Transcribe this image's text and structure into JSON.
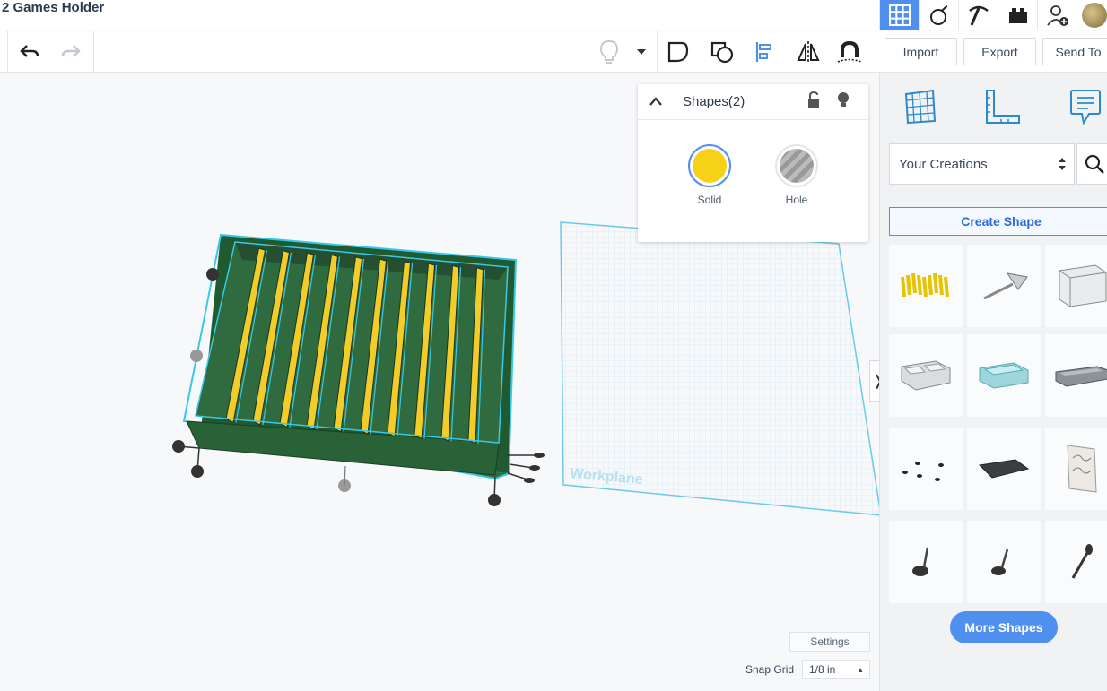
{
  "header": {
    "title": "2 Games Holder"
  },
  "top_icons": [
    "grid-view-icon",
    "bomb-icon",
    "pickaxe-icon",
    "brick-icon",
    "add-user-icon"
  ],
  "toolbar": {
    "undo": "undo-icon",
    "redo": "redo-icon"
  },
  "actions": {
    "import": "Import",
    "export": "Export",
    "send_to": "Send To"
  },
  "inspector": {
    "title": "Shapes(2)",
    "solid_label": "Solid",
    "hole_label": "Hole",
    "solid_color": "#f7d117"
  },
  "sidebar": {
    "category": "Your Creations",
    "create_shape": "Create Shape",
    "more_shapes": "More Shapes"
  },
  "canvas": {
    "workplane_label": "Workplane"
  },
  "footer": {
    "settings": "Settings",
    "snap_grid_label": "Snap Grid",
    "snap_grid_value": "1/8 in"
  },
  "colors": {
    "accent": "#4f8ff0",
    "model_green": "#2f6b3f",
    "selection": "#32c8e6"
  }
}
